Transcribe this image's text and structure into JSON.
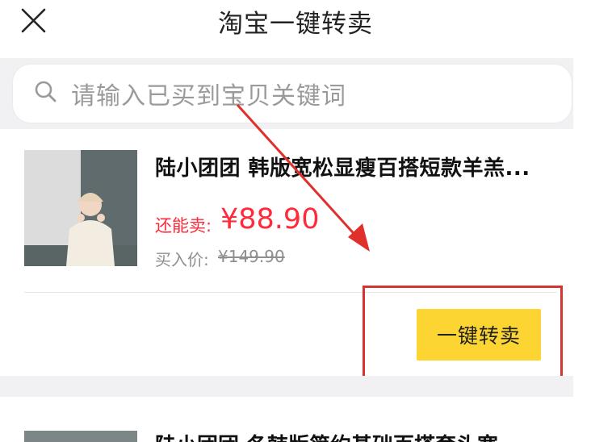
{
  "header": {
    "title": "淘宝一键转卖",
    "close_icon": "close-icon"
  },
  "search": {
    "placeholder": "请输入已买到宝贝关键词",
    "icon": "search-icon"
  },
  "items": [
    {
      "title": "陆小团团 韩版宽松显瘦百搭短款羊羔...",
      "sell_label": "还能卖:",
      "sell_price": "¥88.90",
      "buy_label": "买入价:",
      "buy_price": "¥149.90",
      "button_label": "一键转卖"
    },
    {
      "title": "陆小团团 冬韩版简约基础百搭套头宽"
    }
  ],
  "colors": {
    "price_red": "#ff2a3a",
    "button_yellow": "#fcd533",
    "annotation_red": "#d8332e",
    "band_gray": "#f1f1f3"
  }
}
